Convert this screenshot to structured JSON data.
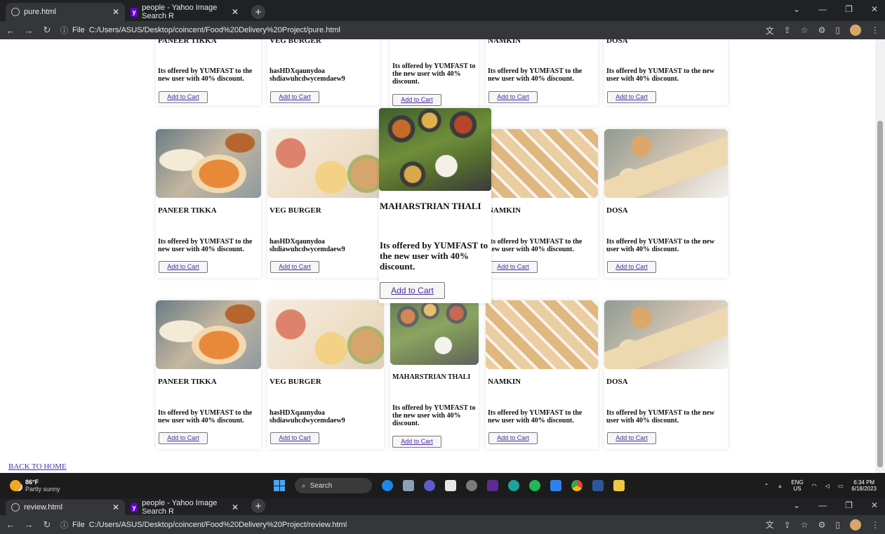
{
  "window1": {
    "tabs": [
      {
        "title": "pure.html",
        "active": true
      },
      {
        "title": "people - Yahoo Image Search R",
        "active": false
      }
    ],
    "new_tab": "+",
    "address_prefix": "File",
    "url": "C:/Users/ASUS/Desktop/coincent/Food%20Delivery%20Project/pure.html"
  },
  "window2": {
    "tabs": [
      {
        "title": "review.html",
        "active": true
      },
      {
        "title": "people - Yahoo Image Search R",
        "active": false
      }
    ],
    "new_tab": "+",
    "address_prefix": "File",
    "url": "C:/Users/ASUS/Desktop/coincent/Food%20Delivery%20Project/review.html"
  },
  "products": {
    "row0": [
      {
        "title": "PANEER TIKKA",
        "desc": "Its offered by YUMFAST to the new user with 40% discount.",
        "button": "Add to Cart"
      },
      {
        "title": "VEG BURGER",
        "desc": "hasHDXqaunydoa shdiawuhcdwycemdaew9",
        "button": "Add to Cart"
      },
      {
        "title": "",
        "desc": "Its offered by YUMFAST to the new user with 40% discount.",
        "button": "Add to Cart"
      },
      {
        "title": "NAMKIN",
        "desc": "Its offered by YUMFAST to the new user with 40% discount.",
        "button": "Add to Cart"
      },
      {
        "title": "DOSA",
        "desc": "Its offered by YUMFAST to the new user with 40% discount.",
        "button": "Add to Cart"
      }
    ],
    "row1": [
      {
        "title": "PANEER TIKKA",
        "desc": "Its offered by YUMFAST to the new user with 40% discount.",
        "button": "Add to Cart"
      },
      {
        "title": "VEG BURGER",
        "desc": "hasHDXqaunydoa shdiawuhcdwycemdaew9",
        "button": "Add to Cart"
      },
      {
        "title": "MAHARSTRIAN THALI",
        "desc": "Its offered by YUMFAST to the new user with 40% discount.",
        "button": "Add to Cart"
      },
      {
        "title": "NAMKIN",
        "desc": "Its offered by YUMFAST to the new user with 40% discount.",
        "button": "Add to Cart"
      },
      {
        "title": "DOSA",
        "desc": "Its offered by YUMFAST to the new user with 40% discount.",
        "button": "Add to Cart"
      }
    ],
    "row2": [
      {
        "title": "PANEER TIKKA",
        "desc": "Its offered by YUMFAST to the new user with 40% discount.",
        "button": "Add to Cart"
      },
      {
        "title": "VEG BURGER",
        "desc": "hasHDXqaunydoa shdiawuhcdwycemdaew9",
        "button": "Add to Cart"
      },
      {
        "title": "MAHARSTRIAN THALI",
        "desc": "Its offered by YUMFAST to the new user with 40% discount.",
        "button": "Add to Cart"
      },
      {
        "title": "NAMKIN",
        "desc": "Its offered by YUMFAST to the new user with 40% discount.",
        "button": "Add to Cart"
      },
      {
        "title": "DOSA",
        "desc": "Its offered by YUMFAST to the new user with 40% discount.",
        "button": "Add to Cart"
      }
    ]
  },
  "back_home": "BACK TO HOME",
  "taskbar": {
    "temp": "86°F",
    "weather": "Partly sunny",
    "search": "Search",
    "lang": "ENG",
    "region": "US",
    "time": "6:34 PM",
    "date": "6/18/2023"
  },
  "colors": {
    "link": "#4b2ca0",
    "chrome_bg": "#202124",
    "toolbar_bg": "#35363a",
    "taskbar_bg": "#1c1c1c"
  }
}
